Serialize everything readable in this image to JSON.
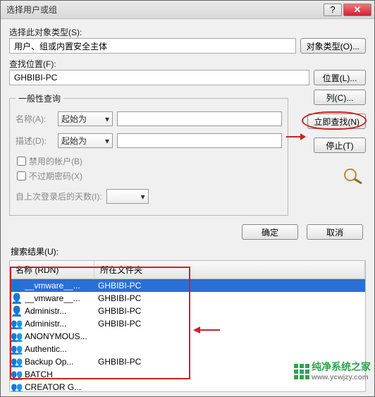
{
  "title": "选择用户或组",
  "section_objtype_label": "选择此对象类型(S):",
  "objtype_value": "用户、组或内置安全主体",
  "objtype_btn": "对象类型(O)...",
  "section_loc_label": "查找位置(F):",
  "loc_value": "GHBIBI-PC",
  "loc_btn": "位置(L)...",
  "general_legend": "一般性查询",
  "name_label": "名称(A):",
  "desc_label": "描述(D):",
  "select_option": "起始为",
  "chk_disabled": "禁用的帐户(B)",
  "chk_neverexpire": "不过期密码(X)",
  "days_label": "自上次登录后的天数(I):",
  "btn_columns": "列(C)...",
  "btn_findnow": "立即查找(N)",
  "btn_stop": "停止(T)",
  "btn_ok": "确定",
  "btn_cancel": "取消",
  "results_label": "搜索结果(U):",
  "col_rdn": "名称 (RDN)",
  "col_folder": "所在文件夹",
  "results": [
    {
      "name": "__vmware__...",
      "folder": "GHBIBI-PC",
      "icon": "👤",
      "selected": true
    },
    {
      "name": "__vmware__...",
      "folder": "GHBIBI-PC",
      "icon": "👤",
      "selected": false
    },
    {
      "name": "Administr...",
      "folder": "GHBIBI-PC",
      "icon": "👤",
      "selected": false
    },
    {
      "name": "Administr...",
      "folder": "GHBIBI-PC",
      "icon": "👥",
      "selected": false
    },
    {
      "name": "ANONYMOUS...",
      "folder": "",
      "icon": "👥",
      "selected": false
    },
    {
      "name": "Authentic...",
      "folder": "",
      "icon": "👥",
      "selected": false
    },
    {
      "name": "Backup Op...",
      "folder": "GHBIBI-PC",
      "icon": "👥",
      "selected": false
    },
    {
      "name": "BATCH",
      "folder": "",
      "icon": "👥",
      "selected": false
    },
    {
      "name": "CREATOR G...",
      "folder": "",
      "icon": "👥",
      "selected": false
    }
  ],
  "watermark_main": "纯净系统之家",
  "watermark_sub": "www.ycwjzy.com"
}
